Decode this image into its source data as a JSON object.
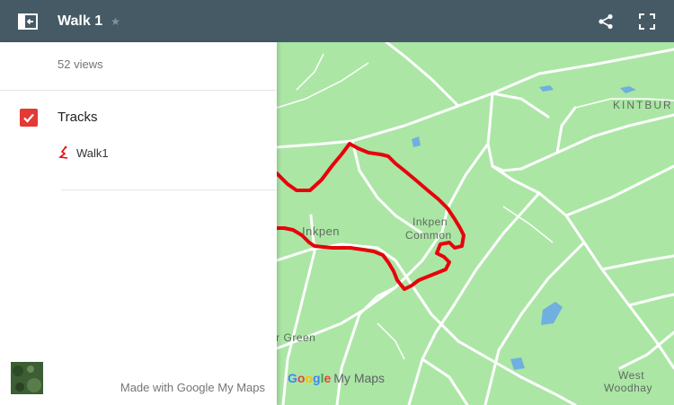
{
  "header": {
    "title": "Walk 1",
    "star_glyph": "★"
  },
  "sidebar": {
    "views": "52 views",
    "layer_title": "Tracks",
    "track_label": "Walk1",
    "made_with": "Made with Google My Maps"
  },
  "map": {
    "labels": {
      "kintbury": "KINTBUR",
      "inkpen": "Inkpen",
      "inkpen_common_1": "Inkpen",
      "inkpen_common_2": "Common",
      "green": "er Green",
      "west_1": "West",
      "west_2": "Woodhay"
    },
    "logo_google": [
      "G",
      "o",
      "o",
      "g",
      "l",
      "e"
    ],
    "logo_mymaps": "My Maps"
  },
  "colors": {
    "header_bg": "#455a64",
    "map_green": "#abe6a5",
    "track_red": "#e8000b",
    "checkbox_red": "#e53935",
    "water_blue": "#6fb0e0"
  }
}
